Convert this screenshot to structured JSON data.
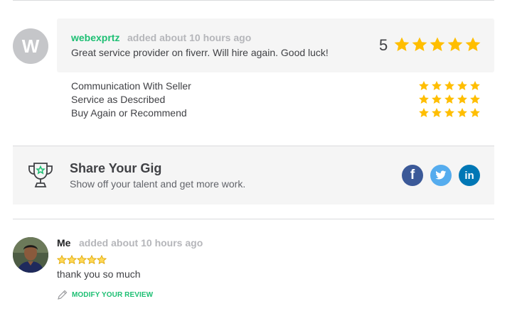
{
  "review1": {
    "avatar_letter": "W",
    "username": "webexprtz",
    "time": "added about 10 hours ago",
    "text": "Great service provider on fiverr. Will hire again. Good luck!",
    "overall_score": "5",
    "overall_stars": 5,
    "breakdown": [
      {
        "label": "Communication With Seller",
        "stars": 5
      },
      {
        "label": "Service as Described",
        "stars": 5
      },
      {
        "label": "Buy Again or Recommend",
        "stars": 5
      }
    ]
  },
  "share": {
    "title": "Share Your Gig",
    "subtitle": "Show off your talent and get more work.",
    "icons": [
      "trophy-icon",
      "facebook-icon",
      "twitter-icon",
      "linkedin-icon"
    ],
    "facebook_glyph": "f",
    "linkedin_glyph": "in"
  },
  "review2": {
    "username": "Me",
    "time": "added about 10 hours ago",
    "stars": 5,
    "text": "thank you so much",
    "modify_label": "MODIFY YOUR REVIEW"
  },
  "colors": {
    "accent_green": "#1dbf73",
    "star_yellow": "#ffbe00",
    "facebook": "#3b5998",
    "twitter": "#55acee",
    "linkedin": "#0077b5"
  }
}
